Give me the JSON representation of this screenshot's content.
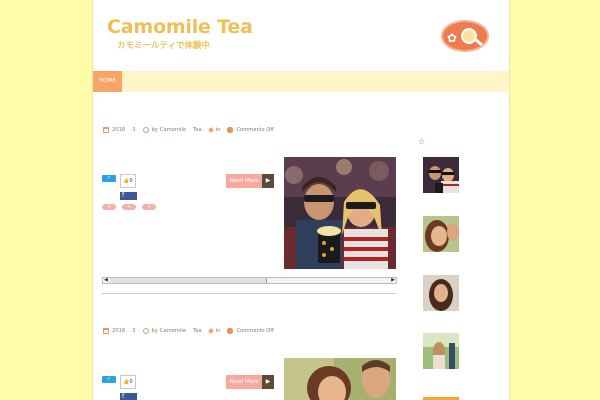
{
  "site": {
    "title": "Camomile Tea",
    "subtitle": "カモミールティで体験中"
  },
  "nav": {
    "items": [
      {
        "label": "HOME",
        "active": true
      }
    ]
  },
  "posts": [
    {
      "meta": {
        "year": "2016",
        "day": "3",
        "author_prefix": "by",
        "author": "Camomile",
        "author2": "Tea",
        "in_label": "in",
        "comments": "Comments Off"
      },
      "share": {
        "twitter": "",
        "like_count": "0",
        "facebook": "f"
      },
      "read_more": "Read More",
      "image": "movie-theater-couple-3d-glasses-popcorn"
    },
    {
      "meta": {
        "year": "2016",
        "day": "3",
        "author_prefix": "by",
        "author": "Camomile",
        "author2": "Tea",
        "in_label": "in",
        "comments": "Comments Off"
      },
      "share": {
        "twitter": "",
        "like_count": "0",
        "facebook": "f"
      },
      "read_more": "Read More",
      "image": "smiling-couple-portrait"
    }
  ],
  "sidebar": {
    "star": "☆",
    "thumbnails": [
      "movie-theater-couple",
      "smiling-woman",
      "woman-portrait",
      "couple-outdoors",
      "sunset-scene"
    ]
  },
  "colors": {
    "background": "#fffca9",
    "title": "#f0bf56",
    "nav_bar": "#fff5c8",
    "nav_active": "#f7a465",
    "read_more": "#f7a9a0",
    "twitter": "#2aa3e0",
    "facebook": "#3b5998"
  }
}
